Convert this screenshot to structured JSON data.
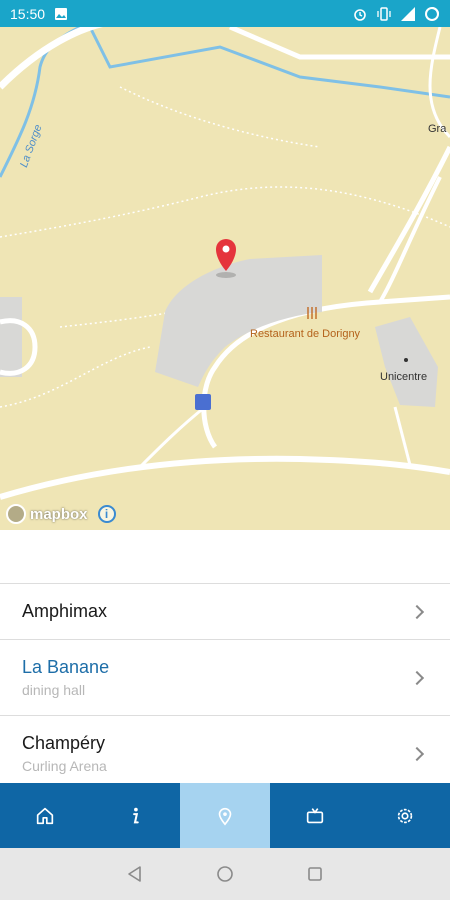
{
  "status_bar": {
    "time": "15:50",
    "icons": [
      "image-icon",
      "alarm-icon",
      "vibrate-icon",
      "signal-icon",
      "battery-icon"
    ]
  },
  "map": {
    "labels": {
      "restaurant": "Restaurant de Dorigny",
      "unicentre": "Unicentre",
      "river": "La Sorge",
      "edge": "Gra"
    },
    "attribution": "mapbox",
    "colors": {
      "land": "#efe5b5",
      "building": "#d8d8d6",
      "road": "#ffffff",
      "water": "#7fc0e6",
      "pin": "#e5343c"
    }
  },
  "list": {
    "items": [
      {
        "title": "Amphimax",
        "subtitle": ""
      },
      {
        "title": "La Banane",
        "subtitle": "dining hall"
      },
      {
        "title": "Champéry",
        "subtitle": "Curling Arena"
      }
    ]
  },
  "tabbar": {
    "tabs": [
      "home-icon",
      "info-icon",
      "map-pin-icon",
      "tv-icon",
      "settings-icon"
    ],
    "active_index": 2,
    "colors": {
      "bar": "#0f66a5",
      "active": "#a6d3f0"
    }
  },
  "navbar": {
    "buttons": [
      "back-icon",
      "home-circle-icon",
      "recents-icon"
    ]
  }
}
